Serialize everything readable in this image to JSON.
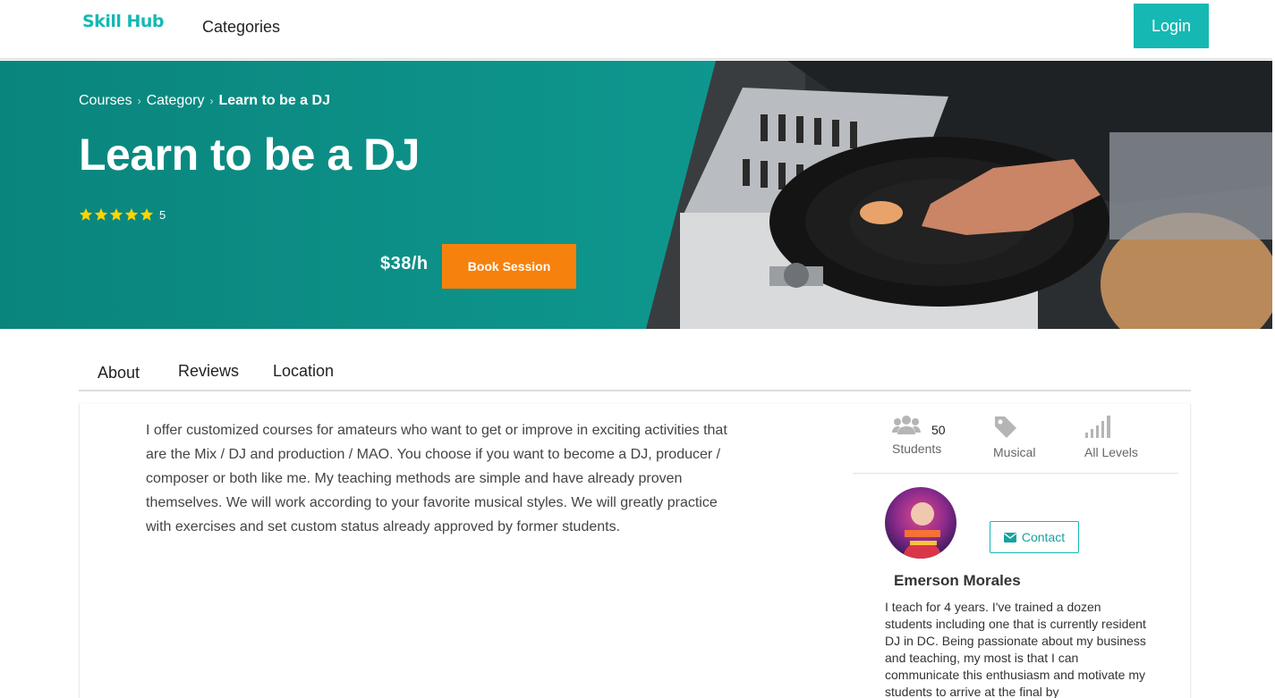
{
  "nav": {
    "logo": "Skill Hub",
    "categories_label": "Categories",
    "login_label": "Login"
  },
  "hero": {
    "breadcrumb": [
      "Courses",
      "Category",
      "Learn to be a DJ"
    ],
    "title": "Learn to be a DJ",
    "rating": 5,
    "rating_label": "5",
    "price": "$38/h",
    "book_label": "Book Session",
    "image": "dj-turntable-photo"
  },
  "tabs": [
    {
      "label": "About",
      "active": true
    },
    {
      "label": "Reviews",
      "active": false
    },
    {
      "label": "Location",
      "active": false
    }
  ],
  "about": {
    "text": "I offer customized courses for amateurs who want to get or improve in exciting activities that are the Mix / DJ and production / MAO. You choose if you want to become a DJ, producer / composer or both like me. My teaching methods are simple and have already proven themselves. We will work according to your favorite musical styles. We will greatly practice with exercises and set custom status already approved by former students."
  },
  "stats": {
    "students_count": "50",
    "students_label": "Students",
    "category_label": "Musical",
    "level_label": "All Levels"
  },
  "teacher": {
    "name": "Emerson Morales",
    "contact_label": "Contact",
    "bio": "I teach for 4 years. I've trained a dozen students including one that is currently resident DJ in DC. Being passionate about my business and teaching, my most is that I can communicate this enthusiasm and motivate my students to arrive at the final by"
  },
  "colors": {
    "brand": "#16b8b3",
    "hero_teal": "#0b8a82",
    "accent_orange": "#f6820d",
    "star": "#ffd400"
  }
}
